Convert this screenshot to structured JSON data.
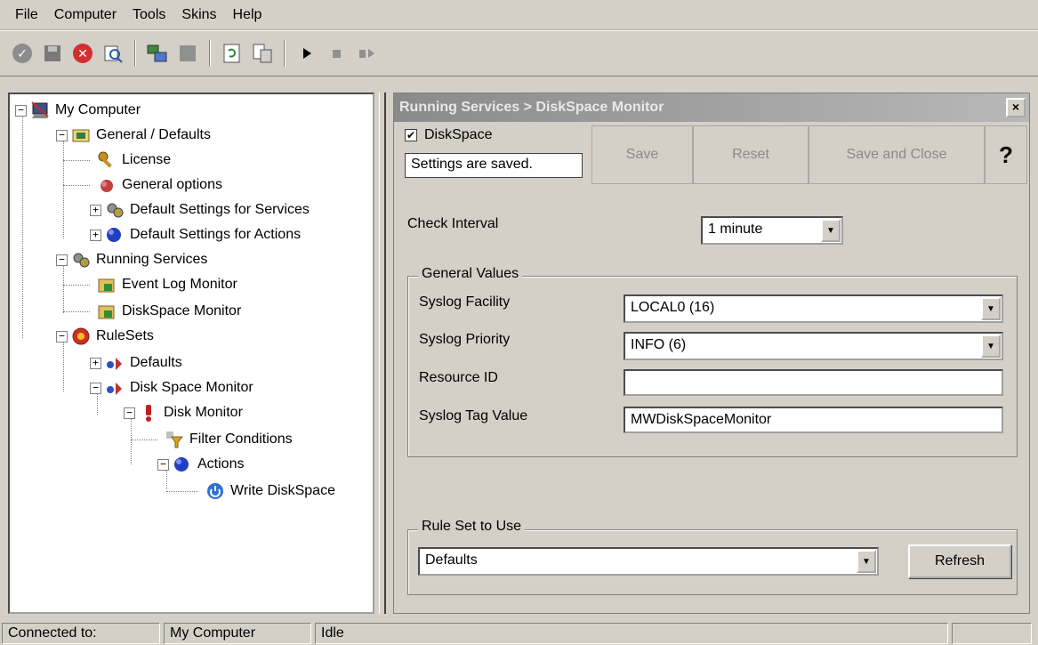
{
  "menu": {
    "file": "File",
    "computer": "Computer",
    "tools": "Tools",
    "skins": "Skins",
    "help": "Help"
  },
  "tree": {
    "my_computer": "My Computer",
    "general_defaults": "General / Defaults",
    "license": "License",
    "general_options": "General options",
    "default_services": "Default Settings for Services",
    "default_actions": "Default Settings for Actions",
    "running_services": "Running Services",
    "event_log_monitor": "Event Log Monitor",
    "diskspace_monitor": "DiskSpace Monitor",
    "rulesets": "RuleSets",
    "defaults": "Defaults",
    "disk_space_monitor": "Disk Space Monitor",
    "disk_monitor": "Disk Monitor",
    "filter_conditions": "Filter Conditions",
    "actions": "Actions",
    "write_diskspace": "Write DiskSpace"
  },
  "panel": {
    "title": "Running Services > DiskSpace Monitor",
    "close": "×",
    "enabled_label": "DiskSpace",
    "enabled_checked": true,
    "checkmark": "✔",
    "status": "Settings are saved.",
    "save": "Save",
    "reset": "Reset",
    "save_close": "Save and Close",
    "help": "?",
    "check_interval_label": "Check Interval",
    "check_interval_value": "1 minute",
    "general_values_title": "General Values",
    "facility_label": "Syslog Facility",
    "facility_value": "LOCAL0 (16)",
    "priority_label": "Syslog Priority",
    "priority_value": "INFO (6)",
    "resource_label": "Resource ID",
    "resource_value": "",
    "tag_label": "Syslog Tag Value",
    "tag_value": "MWDiskSpaceMonitor",
    "ruleset_title": "Rule Set to Use",
    "ruleset_value": "Defaults",
    "refresh": "Refresh"
  },
  "status": {
    "connected_label": "Connected to:",
    "computer": "My Computer",
    "state": "Idle"
  },
  "colors": {
    "face": "#d4d0c8",
    "title_gradient_start": "#8a8a8a",
    "disabled_text": "#8a8a8a"
  }
}
